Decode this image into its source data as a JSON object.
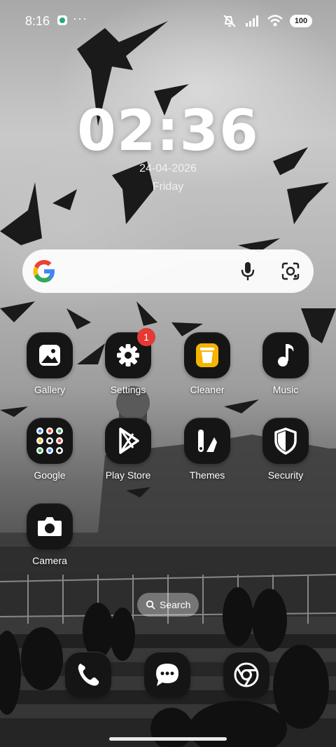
{
  "status_bar": {
    "time": "8:16",
    "more": "···",
    "battery": "100"
  },
  "clock": {
    "time": "02:36",
    "date": "24-04-2026",
    "weekday": "Friday"
  },
  "search_bar": {
    "icons": [
      "google-logo",
      "mic-icon",
      "lens-icon"
    ]
  },
  "apps": [
    {
      "label": "Gallery",
      "icon": "gallery-icon"
    },
    {
      "label": "Settings",
      "icon": "gear-icon",
      "badge": "1"
    },
    {
      "label": "Cleaner",
      "icon": "trash-icon"
    },
    {
      "label": "Music",
      "icon": "music-note-icon"
    },
    {
      "label": "Google",
      "icon": "google-folder-icon"
    },
    {
      "label": "Play Store",
      "icon": "play-store-icon"
    },
    {
      "label": "Themes",
      "icon": "themes-icon"
    },
    {
      "label": "Security",
      "icon": "shield-icon"
    },
    {
      "label": "Camera",
      "icon": "camera-icon"
    }
  ],
  "search_pill": {
    "label": "Search"
  },
  "dock": [
    {
      "icon": "phone-icon"
    },
    {
      "icon": "messages-icon"
    },
    {
      "icon": "chrome-icon"
    }
  ],
  "colors": {
    "badge": "#e53935",
    "cleaner_accent": "#f4b400",
    "tile_bg": "#151515"
  }
}
